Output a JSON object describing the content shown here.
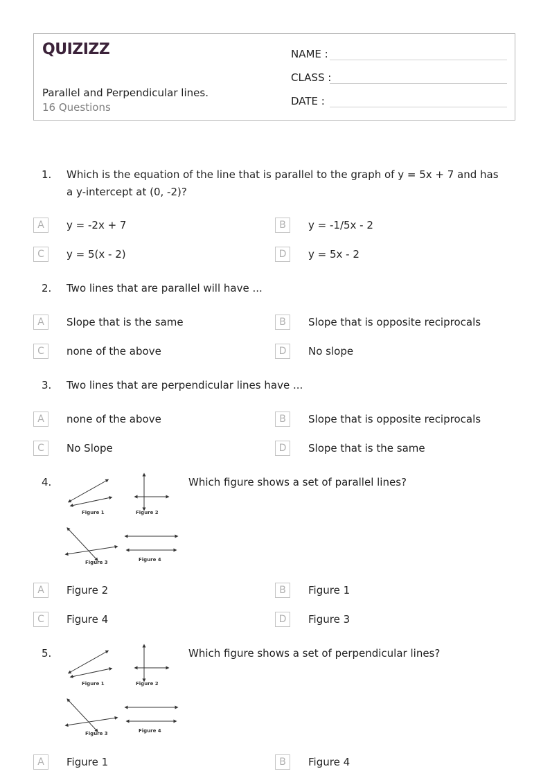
{
  "header": {
    "logo": "QUIZIZZ",
    "title": "Parallel and Perpendicular lines.",
    "question_count": "16 Questions",
    "fields": [
      {
        "label": "NAME :",
        "value": ""
      },
      {
        "label": "CLASS :",
        "value": ""
      },
      {
        "label": "DATE  :",
        "value": ""
      }
    ]
  },
  "questions": [
    {
      "number": "1.",
      "text": "Which is the equation of the line that is parallel to the graph of y = 5x + 7 and has a y-intercept at (0, -2)?",
      "options": [
        {
          "letter": "A",
          "text": "y = -2x + 7"
        },
        {
          "letter": "B",
          "text": "y = -1/5x - 2"
        },
        {
          "letter": "C",
          "text": "y = 5(x - 2)"
        },
        {
          "letter": "D",
          "text": "y = 5x - 2"
        }
      ]
    },
    {
      "number": "2.",
      "text": "Two lines that are parallel will have ...",
      "options": [
        {
          "letter": "A",
          "text": "Slope that is the same"
        },
        {
          "letter": "B",
          "text": "Slope that is opposite reciprocals"
        },
        {
          "letter": "C",
          "text": "none of the above"
        },
        {
          "letter": "D",
          "text": "No slope"
        }
      ]
    },
    {
      "number": "3.",
      "text": "Two lines that are perpendicular lines have ...",
      "options": [
        {
          "letter": "A",
          "text": "none of the above"
        },
        {
          "letter": "B",
          "text": "Slope that is opposite reciprocals"
        },
        {
          "letter": "C",
          "text": "No Slope"
        },
        {
          "letter": "D",
          "text": "Slope that is the same"
        }
      ]
    },
    {
      "number": "4.",
      "text": "Which figure shows a set of parallel lines?",
      "figure_labels": [
        "Figure 1",
        "Figure 2",
        "Figure 3",
        "Figure 4"
      ],
      "options": [
        {
          "letter": "A",
          "text": "Figure 2"
        },
        {
          "letter": "B",
          "text": "Figure 1"
        },
        {
          "letter": "C",
          "text": "Figure 4"
        },
        {
          "letter": "D",
          "text": "Figure 3"
        }
      ]
    },
    {
      "number": "5.",
      "text": "Which figure shows a set of perpendicular lines?",
      "figure_labels": [
        "Figure 1",
        "Figure 2",
        "Figure 3",
        "Figure 4"
      ],
      "options": [
        {
          "letter": "A",
          "text": "Figure 1"
        },
        {
          "letter": "B",
          "text": "Figure 4"
        }
      ]
    }
  ]
}
